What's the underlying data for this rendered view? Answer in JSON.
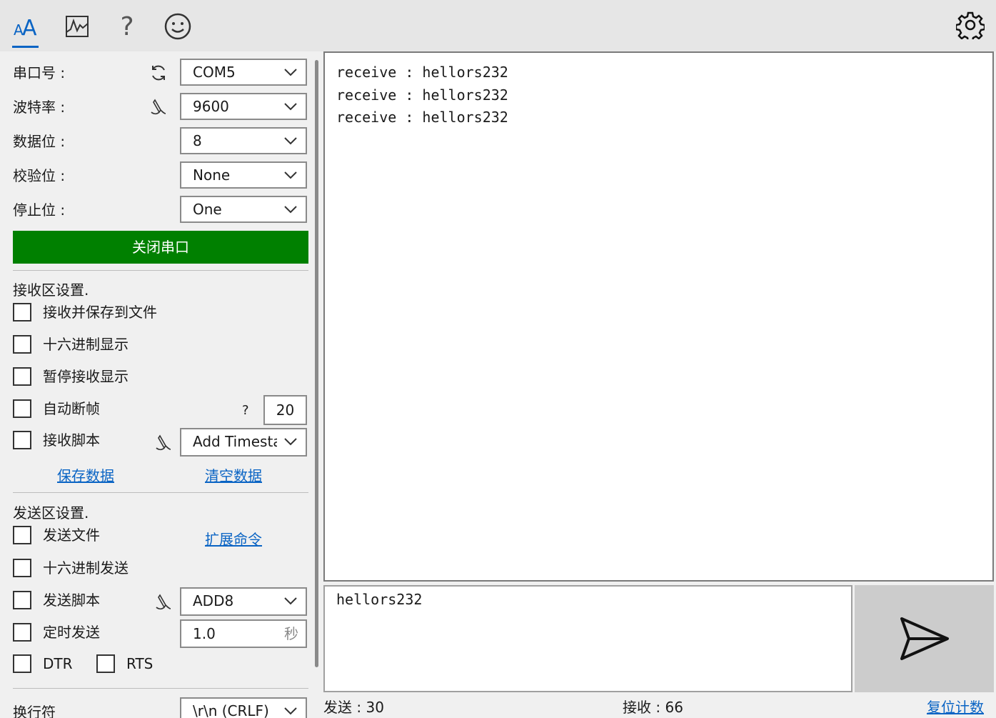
{
  "toolbar": {
    "tabs": [
      {
        "name": "font-icon",
        "active": true
      },
      {
        "name": "chart-icon",
        "active": false
      },
      {
        "name": "help-icon",
        "active": false
      },
      {
        "name": "emoji-icon",
        "active": false
      }
    ],
    "help_glyph": "?",
    "settings_icon": "gear-icon"
  },
  "serial": {
    "port_label": "串口号 :",
    "port_value": "COM5",
    "baud_label": "波特率 :",
    "baud_value": "9600",
    "databits_label": "数据位 :",
    "databits_value": "8",
    "parity_label": "校验位 :",
    "parity_value": "None",
    "stopbits_label": "停止位 :",
    "stopbits_value": "One",
    "toggle_button": "关闭串口",
    "button_color": "#008000"
  },
  "receive_settings": {
    "title": "接收区设置.",
    "save_to_file": "接收并保存到文件",
    "hex_display": "十六进制显示",
    "pause_display": "暂停接收显示",
    "auto_frame": "自动断帧",
    "auto_frame_help": "?",
    "auto_frame_value": "20",
    "script": "接收脚本",
    "script_value": "Add Timesta",
    "save_data": "保存数据",
    "clear_data": "清空数据"
  },
  "send_settings": {
    "title": "发送区设置.",
    "send_file": "发送文件",
    "extended_commands": "扩展命令",
    "hex_send": "十六进制发送",
    "script": "发送脚本",
    "script_value": "ADD8",
    "timed_send": "定时发送",
    "timed_value": "1.0",
    "timed_unit": "秒",
    "dtr": "DTR",
    "rts": "RTS",
    "newline_label": "换行符",
    "newline_value": "\\r\\n (CRLF)"
  },
  "receive_area": {
    "lines": [
      "receive : hellors232",
      "receive : hellors232",
      "receive : hellors232"
    ]
  },
  "send_area": {
    "text": "hellors232"
  },
  "status": {
    "sent_label": "发送 :",
    "sent_value": "30",
    "received_label": "接收 :",
    "received_value": "66",
    "reset_counter": "复位计数"
  },
  "colors": {
    "accent": "#0a64c4",
    "link": "#0a64c4"
  }
}
